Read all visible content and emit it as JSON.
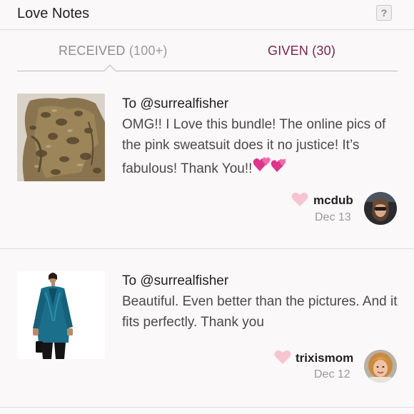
{
  "header": {
    "title": "Love Notes",
    "help_label": "?"
  },
  "tabs": [
    {
      "name": "RECEIVED",
      "count": "(100+)",
      "active": true
    },
    {
      "name": "GIVEN",
      "count": "(30)",
      "active": false
    }
  ],
  "notes": [
    {
      "recipient": "To @surrealfisher",
      "message": "OMG!! I Love this bundle! The online pics of the pink sweatsuit does it no justice! It’s fabulous! Thank You!!",
      "emoji": "two-hearts-emoji",
      "author": "mcdub",
      "date": "Dec 13",
      "thumbnail": "snakeskin-print-top-photo",
      "avatar": "mcdub-avatar-photo"
    },
    {
      "recipient": "To @surrealfisher",
      "message": "Beautiful. Even better than the pictures. And it fits perfectly. Thank you",
      "author": "trixismom",
      "date": "Dec 12",
      "thumbnail": "teal-velvet-blazer-photo",
      "avatar": "trixismom-avatar-photo"
    }
  ],
  "colors": {
    "accent_given": "#7a2540",
    "heart": "#f7c4cf",
    "inline_heart": "#e0338a"
  }
}
